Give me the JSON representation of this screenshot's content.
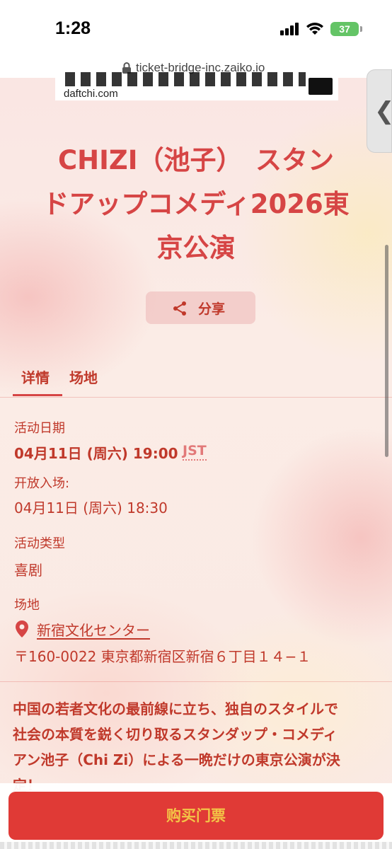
{
  "status_bar": {
    "time": "1:28",
    "battery": "37"
  },
  "url_bar": {
    "url": "ticket-bridge-inc.zaiko.io"
  },
  "banner": {
    "caption": "daftchi.com"
  },
  "side_handle": {
    "glyph": "❮"
  },
  "event": {
    "title": "CHIZI（池子）　スタンドアップコメディ2026東京公演",
    "title_lines": [
      "CHIZI（池子）　スタン",
      "ドアップコメディ2026東",
      "京公演"
    ],
    "share_label": "分享"
  },
  "tabs": [
    {
      "label": "详情",
      "active": true
    },
    {
      "label": "场地",
      "active": false
    }
  ],
  "details": {
    "date_label": "活动日期",
    "date_value": "04月11日 (周六) 19:00",
    "timezone": "JST",
    "doors_label": "开放入场:",
    "doors_value": "04月11日 (周六) 18:30",
    "type_label": "活动类型",
    "type_value": "喜剧",
    "venue_label": "场地",
    "venue_name": "新宿文化センター",
    "venue_address": "〒160-0022 東京都新宿区新宿６丁目１４−１"
  },
  "description": {
    "lines": [
      "中国の若者文化の最前線に立ち、独自のスタイルで",
      "社会の本質を鋭く切り取るスタンダップ・コメディ",
      "アン池子（Chi Zi）による一晩だけの東京公演が決",
      "定！"
    ]
  },
  "buy_button": {
    "label": "购买门票"
  },
  "colors": {
    "accent": "#d64545",
    "text": "#c0392b",
    "button_bg": "#e03a36",
    "button_text": "#f3c447",
    "battery": "#64c466"
  }
}
